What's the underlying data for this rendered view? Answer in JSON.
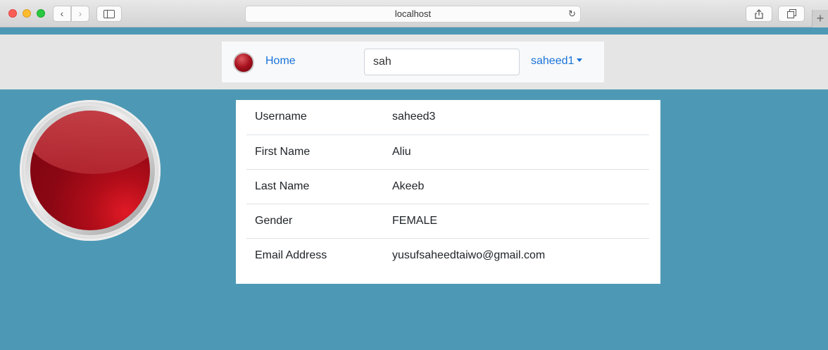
{
  "browser": {
    "url": "localhost"
  },
  "navbar": {
    "home_label": "Home",
    "search_value": "sah",
    "user_label": "saheed1"
  },
  "profile": {
    "rows": [
      {
        "label": "Username",
        "value": "saheed3"
      },
      {
        "label": "First Name",
        "value": "Aliu"
      },
      {
        "label": "Last Name",
        "value": "Akeeb"
      },
      {
        "label": "Gender",
        "value": "FEMALE"
      },
      {
        "label": "Email Address",
        "value": "yusufsaheedtaiwo@gmail.com"
      }
    ]
  },
  "icons": {
    "back": "chevron-left-icon",
    "forward": "chevron-right-icon",
    "sidebar": "sidebar-icon",
    "reload": "reload-icon",
    "share": "share-icon",
    "tabs": "tabs-icon",
    "newtab": "plus-icon"
  },
  "colors": {
    "page_background": "#4d99b5",
    "link": "#1a73d9",
    "navbar": "#f8f9fa"
  }
}
